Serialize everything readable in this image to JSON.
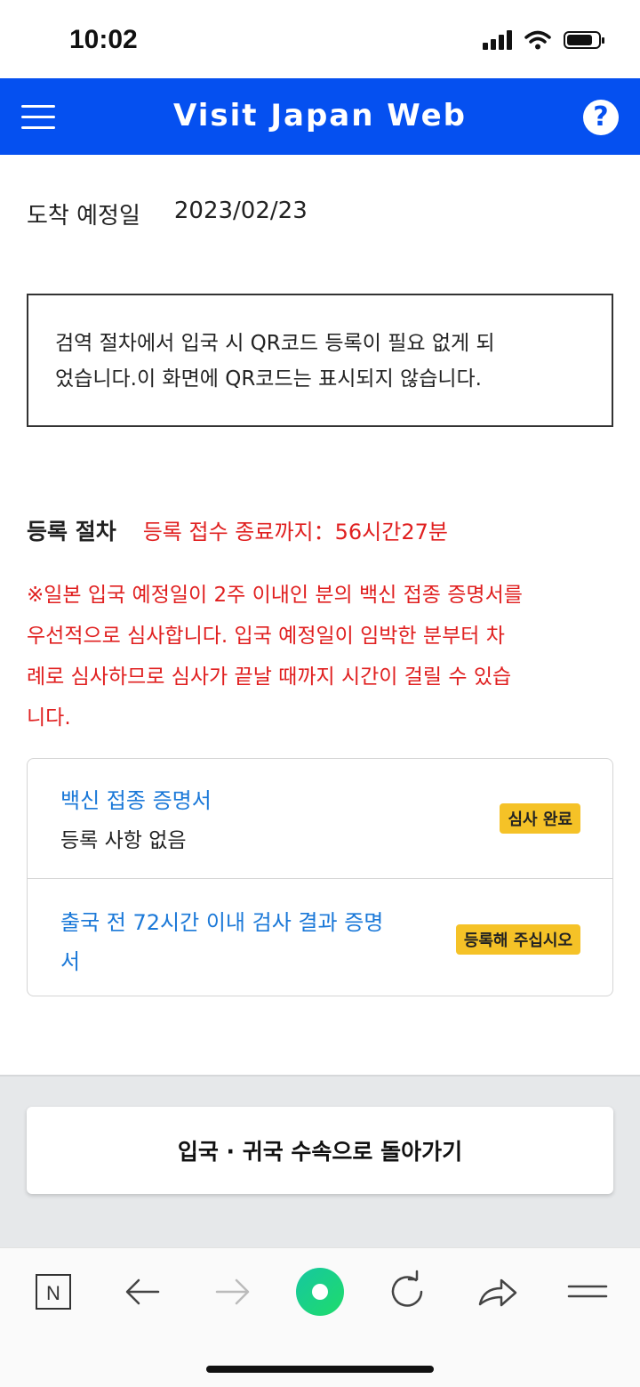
{
  "status_bar": {
    "time": "10:02"
  },
  "header": {
    "title": "Visit Japan Web",
    "menu_icon": "hamburger-menu-icon",
    "help_icon": "help-circle-icon",
    "help_glyph": "?",
    "color": "#0550f0"
  },
  "arrival": {
    "label": "도착 예정일",
    "date": "2023/02/23"
  },
  "notice": {
    "line1": "검역 절차에서 입국 시 QR코드 등록이 필요 없게 되",
    "line2": "었습니다.이 화면에 QR코드는 표시되지 않습니다."
  },
  "registration": {
    "label": "등록 절차",
    "deadline": "등록 접수 종료까지：56시간27분",
    "warning_lines": [
      "※일본 입국 예정일이 2주 이내인 분의 백신 접종 증명서를",
      "우선적으로 심사합니다. 입국 예정일이 임박한 분부터 차",
      "례로 심사하므로 심사가 끝날 때까지 시간이 걸릴 수 있습",
      "니다."
    ]
  },
  "items": [
    {
      "title": "백신 접종 증명서",
      "subtitle": "등록 사항 없음",
      "badge": "심사 완료"
    },
    {
      "title_lines": [
        "출국 전 72시간 이내 검사 결과 증명",
        "서"
      ],
      "badge": "등록해 주십시오"
    }
  ],
  "footer": {
    "back_button": "입국 · 귀국 수속으로 돌아가기"
  },
  "browser_nav": {
    "home_label": "N",
    "icons": [
      "naver-home-icon",
      "back-arrow-icon",
      "forward-arrow-icon",
      "green-dot-icon",
      "refresh-icon",
      "share-icon",
      "menu-icon"
    ]
  },
  "colors": {
    "accent_blue": "#0550f0",
    "alert_red": "#e02020",
    "link_blue": "#1a78d8",
    "badge_yellow": "#f5c227"
  }
}
